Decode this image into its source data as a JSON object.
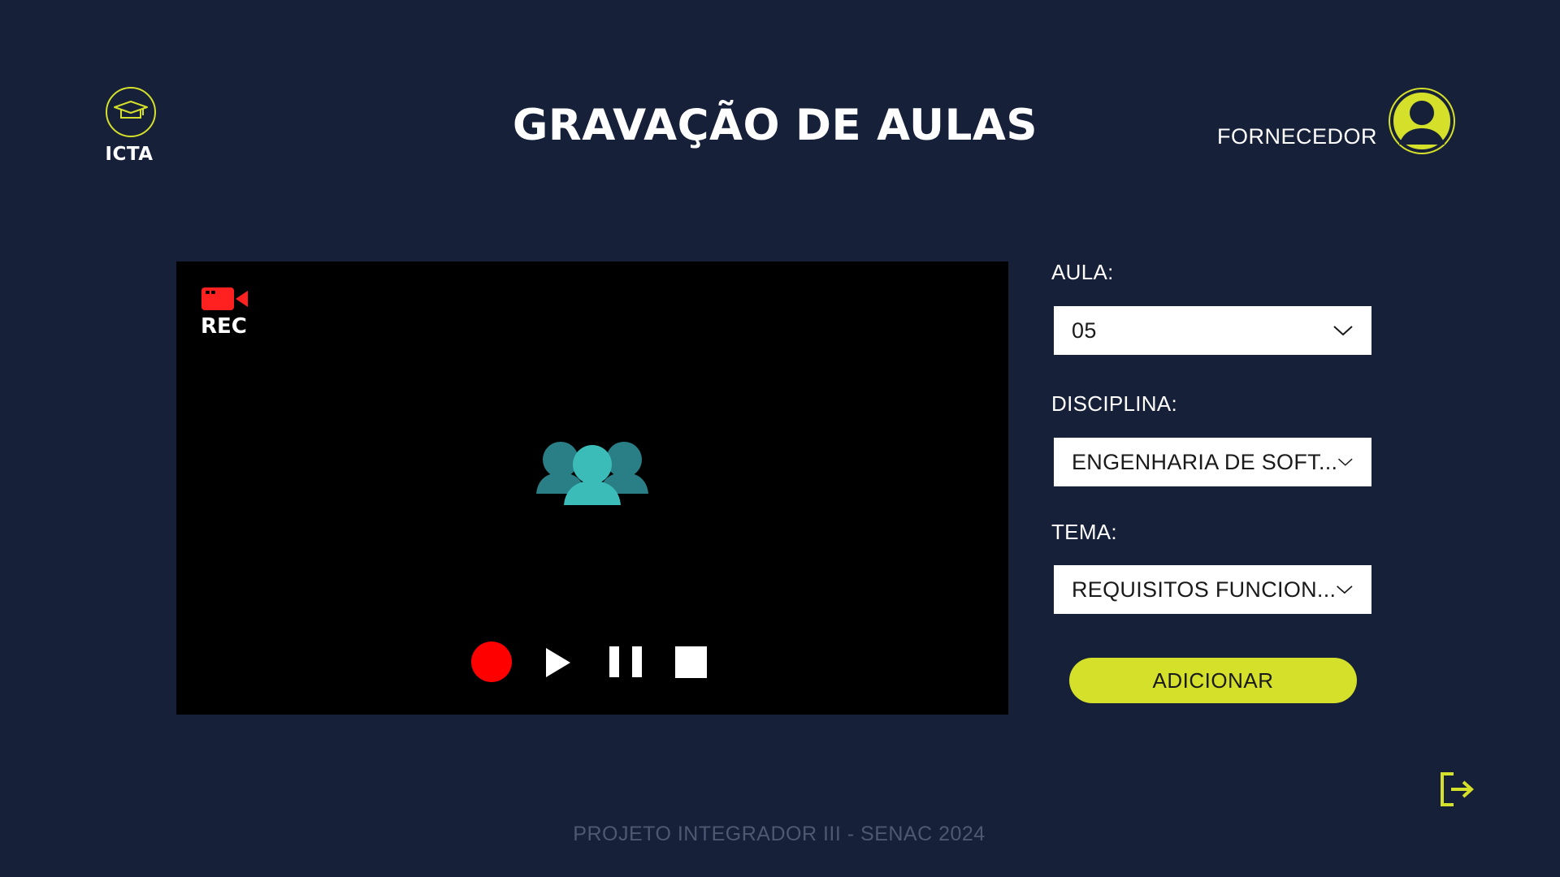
{
  "app": {
    "logo_text": "ICTA",
    "title": "GRAVAÇÃO DE AULAS",
    "user_role": "FORNECEDOR"
  },
  "recorder": {
    "rec_label": "REC",
    "icons": {
      "rec": "video-camera-icon",
      "placeholder": "group-icon",
      "record": "record-icon",
      "play": "play-icon",
      "pause": "pause-icon",
      "stop": "stop-icon"
    }
  },
  "form": {
    "aula": {
      "label": "AULA:",
      "value": "05"
    },
    "disciplina": {
      "label": "DISCIPLINA:",
      "value": "ENGENHARIA DE SOFT..."
    },
    "tema": {
      "label": "TEMA:",
      "value": "REQUISITOS FUNCION..."
    },
    "add_label": "ADICIONAR"
  },
  "footer": {
    "text": "PROJETO INTEGRADOR III - SENAC 2024"
  },
  "colors": {
    "background": "#172039",
    "accent": "#d4e02a",
    "record": "#ff0000",
    "group_icon": "#3bbcb8",
    "footer_text": "#4e5871"
  }
}
